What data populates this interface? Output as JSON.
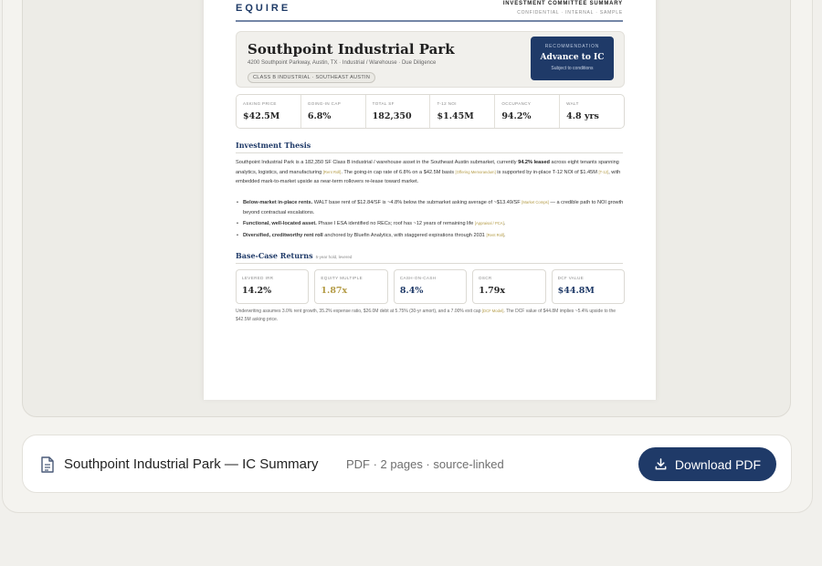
{
  "document": {
    "brand": "EQUIRE",
    "header_title": "INVESTMENT COMMITTEE SUMMARY",
    "header_sub": "CONFIDENTIAL · INTERNAL · SAMPLE",
    "property_title": "Southpoint Industrial Park",
    "address": "4200 Southpoint Parkway, Austin, TX · Industrial / Warehouse · Due Diligence",
    "tag": "CLASS B INDUSTRIAL · SOUTHEAST AUSTIN",
    "recommendation": {
      "label": "RECOMMENDATION",
      "value": "Advance to IC",
      "note": "Subject to conditions"
    },
    "metrics": [
      {
        "label": "ASKING PRICE",
        "value": "$42.5M"
      },
      {
        "label": "GOING-IN CAP",
        "value": "6.8%"
      },
      {
        "label": "TOTAL SF",
        "value": "182,350"
      },
      {
        "label": "T-12 NOI",
        "value": "$1.45M"
      },
      {
        "label": "OCCUPANCY",
        "value": "94.2%"
      },
      {
        "label": "WALT",
        "value": "4.8 yrs"
      }
    ],
    "thesis_title": "Investment Thesis",
    "thesis": {
      "p1": "Southpoint Industrial Park is a 182,350 SF Class B industrial / warehouse asset in the Southeast Austin submarket, currently ",
      "p1_bold": "94.2% leased",
      "p2": " across eight tenants spanning analytics, logistics, and manufacturing ",
      "cite1": "[Rent Roll]",
      "p3": ". The going-in cap rate of 6.8% on a $42.5M basis ",
      "cite2": "[Offering Memorandum]",
      "p4": " is supported by in-place T-12 NOI of $1.45M ",
      "cite3": "[T-12]",
      "p5": ", with embedded mark-to-market upside as near-term rollovers re-lease toward market."
    },
    "bullets": [
      {
        "bold": "Below-market in-place rents.",
        "text": " WALT base rent of $12.84/SF is ~4.8% below the submarket asking average of ~$13.49/SF ",
        "cite": "[Market Comps]",
        "tail": " — a credible path to NOI growth beyond contractual escalations."
      },
      {
        "bold": "Functional, well-located asset.",
        "text": " Phase I ESA identified no RECs; roof has ~12 years of remaining life ",
        "cite": "[Appraisal / PCA]",
        "tail": "."
      },
      {
        "bold": "Diversified, creditworthy rent roll",
        "text": " anchored by Bluefin Analytics, with staggered expirations through 2031 ",
        "cite": "[Rent Roll]",
        "tail": "."
      }
    ],
    "returns_title": "Base-Case Returns",
    "returns_note": "5-year hold, levered",
    "returns": [
      {
        "label": "LEVERED IRR",
        "value": "14.2%"
      },
      {
        "label": "EQUITY MULTIPLE",
        "value": "1.87x"
      },
      {
        "label": "CASH-ON-CASH",
        "value": "8.4%"
      },
      {
        "label": "DSCR",
        "value": "1.79x"
      },
      {
        "label": "DCF VALUE",
        "value": "$44.8M"
      }
    ],
    "footnote": {
      "text": "Underwriting assumes 3.0% rent growth, 35.2% expense ratio, $26.0M debt at 5.75% (30-yr amort), and a 7.00% exit cap ",
      "cite": "[DCF Model]",
      "tail": ". The DCF value of $44.8M implies ~5.4% upside to the $42.5M asking price."
    }
  },
  "file_bar": {
    "name": "Southpoint Industrial Park — IC Summary",
    "meta": "PDF · 2 pages · source-linked",
    "download_label": "Download PDF",
    "file_icon": "document-icon",
    "download_icon": "download-icon"
  },
  "colors": {
    "brand_navy": "#1f3a68",
    "gold_accent": "#b39a44",
    "page_bg": "#f1f0ec"
  }
}
